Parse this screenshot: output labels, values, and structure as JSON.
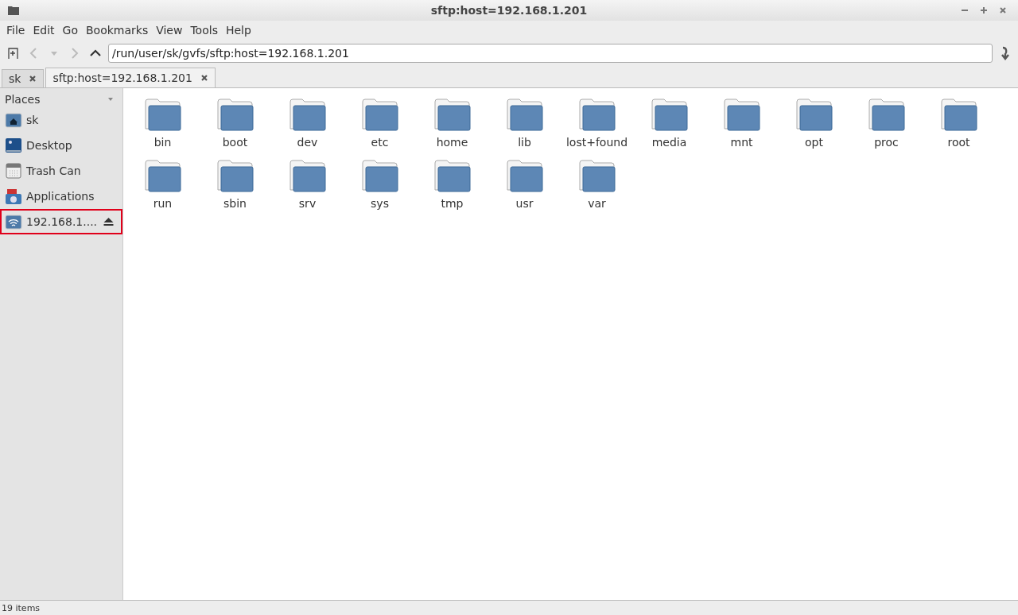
{
  "window": {
    "title": "sftp:host=192.168.1.201"
  },
  "menu": [
    "File",
    "Edit",
    "Go",
    "Bookmarks",
    "View",
    "Tools",
    "Help"
  ],
  "location": {
    "value": "/run/user/sk/gvfs/sftp:host=192.168.1.201"
  },
  "tabs": [
    {
      "label": "sk",
      "selected": false
    },
    {
      "label": "sftp:host=192.168.1.201",
      "selected": true
    }
  ],
  "sidebar": {
    "title": "Places",
    "items": [
      {
        "label": "sk",
        "kind": "home",
        "highlighted": false
      },
      {
        "label": "Desktop",
        "kind": "desktop",
        "highlighted": false
      },
      {
        "label": "Trash Can",
        "kind": "trash",
        "highlighted": false
      },
      {
        "label": "Applications",
        "kind": "apps",
        "highlighted": false
      },
      {
        "label": "192.168.1....",
        "kind": "network",
        "highlighted": true
      }
    ]
  },
  "folders": [
    "bin",
    "boot",
    "dev",
    "etc",
    "home",
    "lib",
    "lost+found",
    "media",
    "mnt",
    "opt",
    "proc",
    "root",
    "run",
    "sbin",
    "srv",
    "sys",
    "tmp",
    "usr",
    "var"
  ],
  "status_bar": "19 items"
}
